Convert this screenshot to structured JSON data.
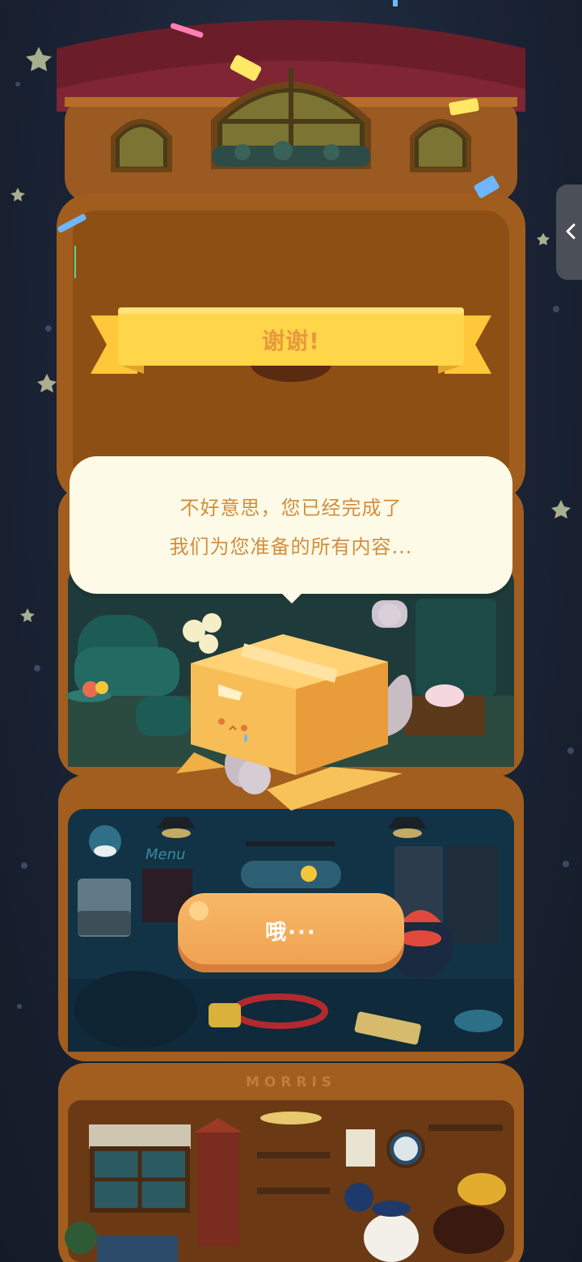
{
  "dialog": {
    "banner_title": "谢谢!",
    "message_line_1": "不好意思，您已经完成了",
    "message_line_2": "我们为您准备的所有内容...",
    "confirm_label": "哦···"
  },
  "scene": {
    "shop_sign": "MORRIS",
    "neon_sign": "Menu"
  },
  "side_panel": {
    "toggle_icon": "chevron-left-icon"
  },
  "colors": {
    "background": "#1b2433",
    "banner": "#ffd34d",
    "banner_text": "#e79a3d",
    "bubble": "#fdfbe7",
    "bubble_text": "#d28d3f",
    "button": "#f0a352",
    "button_text": "#ffffff"
  }
}
